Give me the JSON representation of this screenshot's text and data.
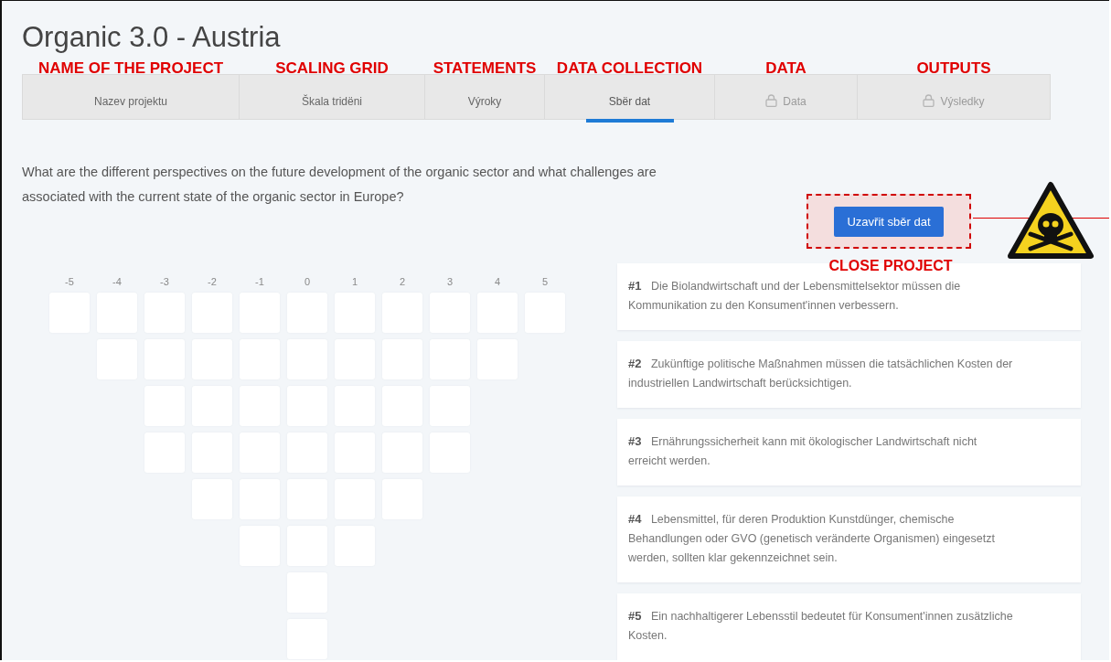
{
  "title": "Organic 3.0 - Austria",
  "tabs": [
    {
      "label": "Nazev projektu",
      "annotation": "NAME OF THE PROJECT",
      "selected": false,
      "locked": false
    },
    {
      "label": "Škala tridëni",
      "annotation": "SCALING GRID",
      "selected": false,
      "locked": false
    },
    {
      "label": "Výroky",
      "annotation": "STATEMENTS",
      "selected": false,
      "locked": false
    },
    {
      "label": "Sbër dat",
      "annotation": "DATA COLLECTION",
      "selected": true,
      "locked": false
    },
    {
      "label": "Data",
      "annotation": "DATA",
      "selected": false,
      "locked": true
    },
    {
      "label": "Výsledky",
      "annotation": "OUTPUTS",
      "selected": false,
      "locked": true
    }
  ],
  "question": "What are the different perspectives on the future development of the organic sector and what challenges are associated with the current state of the organic sector in Europe?",
  "close_button": {
    "label": "Uzavřit sběr dat",
    "annotation": "CLOSE PROJECT"
  },
  "grid": {
    "columns": [
      {
        "label": "-5",
        "cells": [
          {
            "filled": false
          }
        ]
      },
      {
        "label": "-4",
        "cells": [
          {
            "filled": false
          },
          {
            "filled": false
          }
        ]
      },
      {
        "label": "-3",
        "cells": [
          {
            "filled": false
          },
          {
            "filled": false
          },
          {
            "filled": false
          },
          {
            "filled": false
          }
        ]
      },
      {
        "label": "-2",
        "cells": [
          {
            "filled": false
          },
          {
            "filled": false
          },
          {
            "filled": false
          },
          {
            "filled": false
          },
          {
            "filled": false
          }
        ]
      },
      {
        "label": "-1",
        "cells": [
          {
            "filled": false
          },
          {
            "filled": false
          },
          {
            "filled": false
          },
          {
            "filled": false
          },
          {
            "filled": false
          },
          {
            "filled": false
          }
        ]
      },
      {
        "label": "0",
        "cells": [
          {
            "filled": false
          },
          {
            "filled": false
          },
          {
            "filled": false
          },
          {
            "filled": false
          },
          {
            "filled": false
          },
          {
            "filled": false
          },
          {
            "filled": false
          },
          {
            "filled": false
          }
        ]
      },
      {
        "label": "1",
        "cells": [
          {
            "filled": false
          },
          {
            "filled": false
          },
          {
            "filled": false
          },
          {
            "filled": false
          },
          {
            "filled": false
          },
          {
            "filled": false
          }
        ]
      },
      {
        "label": "2",
        "cells": [
          {
            "filled": false
          },
          {
            "filled": false
          },
          {
            "filled": false
          },
          {
            "filled": false
          },
          {
            "filled": false
          }
        ]
      },
      {
        "label": "3",
        "cells": [
          {
            "filled": false
          },
          {
            "filled": false
          },
          {
            "filled": false
          },
          {
            "filled": false
          }
        ]
      },
      {
        "label": "4",
        "cells": [
          {
            "filled": false
          },
          {
            "filled": false
          }
        ]
      },
      {
        "label": "5",
        "cells": [
          {
            "filled": false
          }
        ]
      }
    ]
  },
  "statements": [
    {
      "number": "#1",
      "text": "Die Biolandwirtschaft und der Lebensmittelsektor müssen die Kommunikation zu den Konsument'innen verbessern."
    },
    {
      "number": "#2",
      "text": "Zukünftige politische Maßnahmen müssen die tatsächlichen Kosten der industriellen Landwirtschaft berücksichtigen."
    },
    {
      "number": "#3",
      "text": "Ernährungssicherheit kann mit ökologischer Landwirtschaft nicht erreicht werden."
    },
    {
      "number": "#4",
      "text": "Lebensmittel, für deren Produktion Kunstdünger, chemische Behandlungen oder GVO (genetisch veränderte Organismen) eingesetzt werden, sollten klar gekennzeichnet sein."
    },
    {
      "number": "#5",
      "text": "Ein nachhaltigerer Lebensstil bedeutet für Konsument'innen zusätzliche Kosten."
    }
  ]
}
